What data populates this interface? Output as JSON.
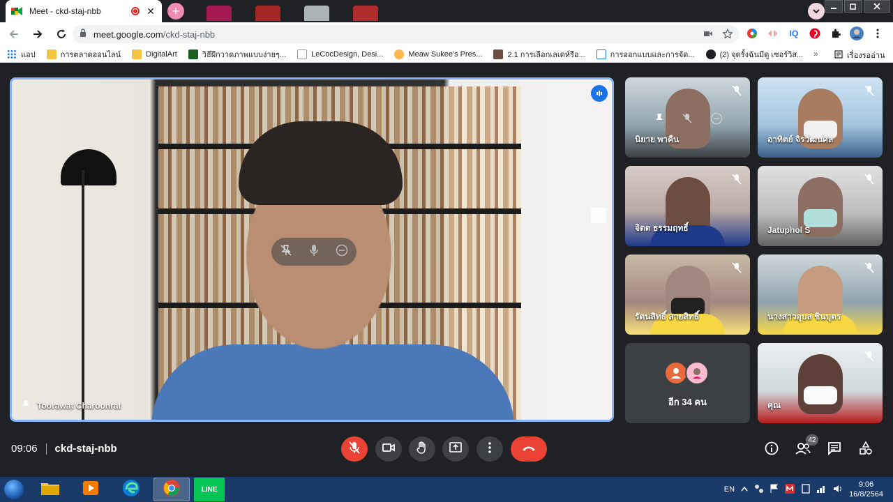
{
  "browser": {
    "tab_title": "Meet - ckd-staj-nbb",
    "tab_close": "✕",
    "new_tab": "+",
    "url_host": "meet.google.com",
    "url_path": "/ckd-staj-nbb",
    "extensions": [
      "color-wheel-icon",
      "pattern-icon",
      "IQ",
      "pinterest-icon",
      "puzzle-icon",
      "profile-avatar"
    ],
    "ext_iq_label": "IQ"
  },
  "bookmarks": {
    "items": [
      {
        "label": "แอป",
        "icon": "apps-grid-icon"
      },
      {
        "label": "การตลาดออนไลน์",
        "icon": "folder-icon"
      },
      {
        "label": "DigitalArt",
        "icon": "folder-icon"
      },
      {
        "label": "วิธีฝึกวาดภาพแบบง่ายๆ...",
        "icon": "site-icon"
      },
      {
        "label": "LeCocDesign, Desi...",
        "icon": "site-icon"
      },
      {
        "label": "Meaw Sukee's Pres...",
        "icon": "site-icon"
      },
      {
        "label": "2.1 การเลือกเลเดห์รือ...",
        "icon": "site-icon"
      },
      {
        "label": "การออกแบบและการจัด...",
        "icon": "site-icon"
      },
      {
        "label": "(2) จุดรั้งฉันมีดู เซอร์วิส...",
        "icon": "site-icon"
      }
    ],
    "more": "»",
    "reading_list": "เรื่องรออ่าน"
  },
  "meeting": {
    "main_speaker": "Toorawat Charoonrat",
    "participants": [
      {
        "name": "นิยาย พาคืน",
        "muted": true
      },
      {
        "name": "อาทิตย์ จิรวัฒนศิล",
        "muted": true
      },
      {
        "name": "จิตด ธรรมฤทธิ์",
        "muted": true
      },
      {
        "name": "Jatuphol S",
        "muted": true
      },
      {
        "name": "รัตนสิทธิ์ สายสิทธิ์",
        "muted": true
      },
      {
        "name": "นางสาวอุบล ชินบุตร",
        "muted": true
      },
      {
        "name": "คุณ",
        "muted": true
      }
    ],
    "more_people": "อีก 34 คน",
    "time": "09:06",
    "code": "ckd-staj-nbb",
    "people_count": "42"
  },
  "taskbar": {
    "lang": "EN",
    "time": "9:06",
    "date": "16/8/2564",
    "line_label": "LINE"
  },
  "colors": {
    "meet_bg": "#202124",
    "tile_bg": "#3c4043",
    "active_border": "#8ab4f8",
    "danger": "#ea4335",
    "accent": "#1a73e8"
  }
}
